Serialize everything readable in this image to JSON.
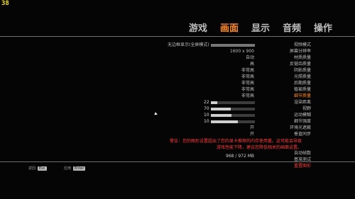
{
  "hud": {
    "fps": "38"
  },
  "tabs": [
    "游戏",
    "画面",
    "显示",
    "音频",
    "操作"
  ],
  "active_tab_index": 1,
  "rows": [
    {
      "label": "视频模式",
      "value": "无边框显示(全屏模式)",
      "kind": "text",
      "bar": 1.0,
      "bar_from_right": true
    },
    {
      "label": "屏幕分辨率",
      "value": "1600 x 900",
      "kind": "text"
    },
    {
      "label": "材质质量",
      "value": "自动",
      "kind": "text"
    },
    {
      "label": "反锯齿质量",
      "value": "高",
      "kind": "text"
    },
    {
      "label": "阴影质量",
      "value": "非常高",
      "kind": "text"
    },
    {
      "label": "光照质量",
      "value": "非常高",
      "kind": "text"
    },
    {
      "label": "后期质量",
      "value": "非常高",
      "kind": "text"
    },
    {
      "label": "植被质量",
      "value": "非常高",
      "kind": "text"
    },
    {
      "label": "细节质量",
      "value": "非常高",
      "kind": "text",
      "highlight": true
    },
    {
      "label": "渲染距离",
      "value": "22",
      "kind": "slider",
      "fill": 0.15
    },
    {
      "label": "视野",
      "value": "70",
      "kind": "slider",
      "fill": 0.45
    },
    {
      "label": "运动模糊",
      "value": "10",
      "kind": "slider",
      "fill": 0.47
    },
    {
      "label": "细节强度",
      "value": "10",
      "kind": "slider",
      "fill": 0.62
    },
    {
      "label": "环境光遮蔽",
      "value": "开",
      "kind": "text"
    },
    {
      "label": "垂直同步",
      "value": "开",
      "kind": "text"
    },
    {
      "label": "自动帧数",
      "value": "",
      "kind": "text",
      "gap": true
    },
    {
      "label": "基准测试",
      "value": "",
      "kind": "text"
    },
    {
      "label": "重置图形",
      "value": "",
      "kind": "text",
      "red": true
    }
  ],
  "warning": {
    "line1": "警告：您的图形设置超出了您的显卡推荐的内存使用量。这可能会导致",
    "line2": "游戏性能下降，建议您降低相关的画面设置。"
  },
  "vram": "968 / 972 MB",
  "footer": {
    "back_label": "返回",
    "back_key": "Esc",
    "apply_label": "应用",
    "apply_key": "Enter"
  },
  "colors": {
    "accent": "#ff8a2a",
    "warning": "#ff3d3d",
    "fps": "#f0e020"
  }
}
